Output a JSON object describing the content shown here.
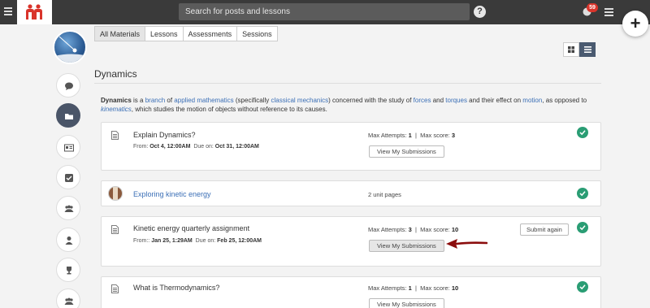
{
  "topbar": {
    "search_placeholder": "Search for posts and lessons",
    "help_glyph": "?",
    "notification_count": "59",
    "fab_glyph": "+"
  },
  "tabs": [
    {
      "label": "All Materials",
      "active": true
    },
    {
      "label": "Lessons",
      "active": false
    },
    {
      "label": "Assessments",
      "active": false
    },
    {
      "label": "Sessions",
      "active": false
    }
  ],
  "heading": "Dynamics",
  "description": {
    "bold_term": "Dynamics",
    "t1": " is a ",
    "l1": "branch",
    "t2": " of ",
    "l2": "applied mathematics",
    "t3": " (specifically ",
    "l3": "classical mechanics",
    "t4": ") concerned with the study of ",
    "l4": "forces",
    "t5": " and ",
    "l5": "torques",
    "t6": " and their effect on ",
    "l6": "motion",
    "t7": ", as opposed to ",
    "l7": "kinematics",
    "t8": ", which studies the motion of objects without reference to its causes."
  },
  "cards": {
    "c1": {
      "title": "Explain Dynamics?",
      "from_label": "From:",
      "from": "Oct 4, 12:00AM",
      "due_label": "Due on:",
      "due": "Oct 31, 12:00AM",
      "attempts_label": "Max Attempts:",
      "attempts": "1",
      "score_label": "Max score:",
      "score": "3",
      "button": "View My Submissions"
    },
    "c2": {
      "title": "Exploring kinetic energy",
      "pages": "2 unit pages"
    },
    "c3": {
      "title": "Kinetic energy quarterly assignment",
      "from_label": "From::",
      "from": "Jan 25, 1:29AM",
      "due_label": "Due on:",
      "due": "Feb 25, 12:00AM",
      "attempts_label": "Max Attempts:",
      "attempts": "3",
      "score_label": "Max score:",
      "score": "10",
      "button": "View My Submissions",
      "submit_again": "Submit again"
    },
    "c4": {
      "title": "What is Thermodynamics?",
      "attempts_label": "Max Attempts:",
      "attempts": "1",
      "score_label": "Max score:",
      "score": "10",
      "button": "View My Submissions"
    }
  },
  "colors": {
    "topbar": "#3a3a3a",
    "brand": "#d9342b",
    "link": "#3b6fb6",
    "check": "#2a9d74",
    "arrow": "#8b0d0d"
  },
  "sidebar_icons": [
    "comment-icon",
    "folder-icon",
    "id-card-icon",
    "checkbox-icon",
    "group-icon",
    "user-icon",
    "trophy-icon",
    "group-icon"
  ]
}
